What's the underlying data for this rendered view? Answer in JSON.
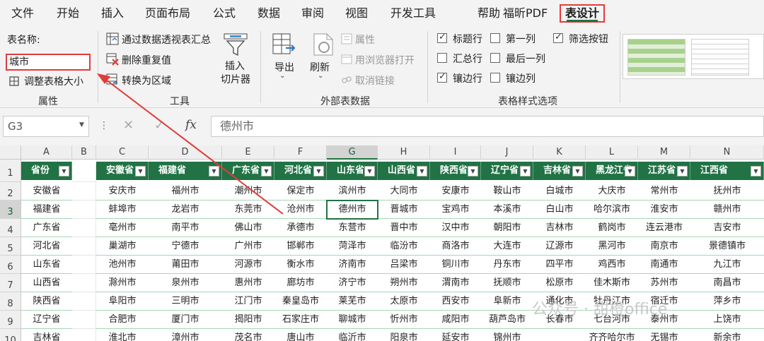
{
  "menu": {
    "tabs": [
      "文件",
      "开始",
      "插入",
      "页面布局",
      "公式",
      "数据",
      "审阅",
      "视图",
      "开发工具",
      "帮助",
      "福昕PDF",
      "表设计"
    ],
    "active": "表设计"
  },
  "ribbon": {
    "properties": {
      "table_name_label": "表名称:",
      "table_name_value": "城市",
      "resize_label": "调整表格大小",
      "group_label": "属性"
    },
    "tools": {
      "pivot_label": "通过数据透视表汇总",
      "remove_dup_label": "删除重复值",
      "convert_range_label": "转换为区域",
      "slicer_label_1": "插入",
      "slicer_label_2": "切片器",
      "group_label": "工具"
    },
    "external": {
      "export_label": "导出",
      "refresh_label": "刷新",
      "properties_label": "属性",
      "open_browser_label": "用浏览器打开",
      "unlink_label": "取消链接",
      "group_label": "外部表数据"
    },
    "style_options": {
      "header_row": "标题行",
      "total_row": "汇总行",
      "banded_rows": "镶边行",
      "first_column": "第一列",
      "last_column": "最后一列",
      "banded_columns": "镶边列",
      "filter_button": "筛选按钮",
      "group_label": "表格样式选项"
    }
  },
  "formula_bar": {
    "name_box": "G3",
    "formula": "德州市",
    "fx": "fx"
  },
  "grid": {
    "columns": [
      "A",
      "B",
      "C",
      "D",
      "E",
      "F",
      "G",
      "H",
      "I",
      "J",
      "K",
      "L",
      "M",
      "N"
    ],
    "rows": [
      "1",
      "2",
      "3",
      "4",
      "5",
      "6",
      "7",
      "8",
      "9",
      "10"
    ],
    "col_a": {
      "header": "省份",
      "values": [
        "安徽省",
        "福建省",
        "广东省",
        "河北省",
        "山东省",
        "山西省",
        "陕西省",
        "辽宁省",
        "吉林省"
      ]
    },
    "table": {
      "headers": [
        "安徽省",
        "福建省",
        "广东省",
        "河北省",
        "山东省",
        "山西省",
        "陕西省",
        "辽宁省",
        "吉林省",
        "黑龙江省",
        "江苏省",
        "江西省"
      ],
      "rows": [
        [
          "安庆市",
          "福州市",
          "潮州市",
          "保定市",
          "滨州市",
          "大同市",
          "安康市",
          "鞍山市",
          "白城市",
          "大庆市",
          "常州市",
          "抚州市"
        ],
        [
          "蚌埠市",
          "龙岩市",
          "东莞市",
          "沧州市",
          "德州市",
          "晋城市",
          "宝鸡市",
          "本溪市",
          "白山市",
          "哈尔滨市",
          "淮安市",
          "赣州市"
        ],
        [
          "亳州市",
          "南平市",
          "佛山市",
          "承德市",
          "东营市",
          "晋中市",
          "汉中市",
          "朝阳市",
          "吉林市",
          "鹤岗市",
          "连云港市",
          "吉安市"
        ],
        [
          "巢湖市",
          "宁德市",
          "广州市",
          "邯郸市",
          "菏泽市",
          "临汾市",
          "商洛市",
          "大连市",
          "辽源市",
          "黑河市",
          "南京市",
          "景德镇市"
        ],
        [
          "池州市",
          "莆田市",
          "河源市",
          "衡水市",
          "济南市",
          "吕梁市",
          "铜川市",
          "丹东市",
          "四平市",
          "鸡西市",
          "南通市",
          "九江市"
        ],
        [
          "滁州市",
          "泉州市",
          "惠州市",
          "廊坊市",
          "济宁市",
          "朔州市",
          "渭南市",
          "抚顺市",
          "松原市",
          "佳木斯市",
          "苏州市",
          "南昌市"
        ],
        [
          "阜阳市",
          "三明市",
          "江门市",
          "秦皇岛市",
          "莱芜市",
          "太原市",
          "西安市",
          "阜新市",
          "通化市",
          "牡丹江市",
          "宿迁市",
          "萍乡市"
        ],
        [
          "合肥市",
          "厦门市",
          "揭阳市",
          "石家庄市",
          "聊城市",
          "忻州市",
          "咸阳市",
          "葫芦岛市",
          "长春市",
          "七台河市",
          "泰州市",
          "上饶市"
        ],
        [
          "淮北市",
          "漳州市",
          "茂名市",
          "唐山市",
          "临沂市",
          "阳泉市",
          "延安市",
          "锦州市",
          "",
          "齐齐哈尔市",
          "无锡市",
          "新余市"
        ]
      ]
    }
  },
  "watermark": "公众号 · 甜橙office",
  "colors": {
    "accent": "#217346",
    "highlight": "#e23b3b"
  }
}
